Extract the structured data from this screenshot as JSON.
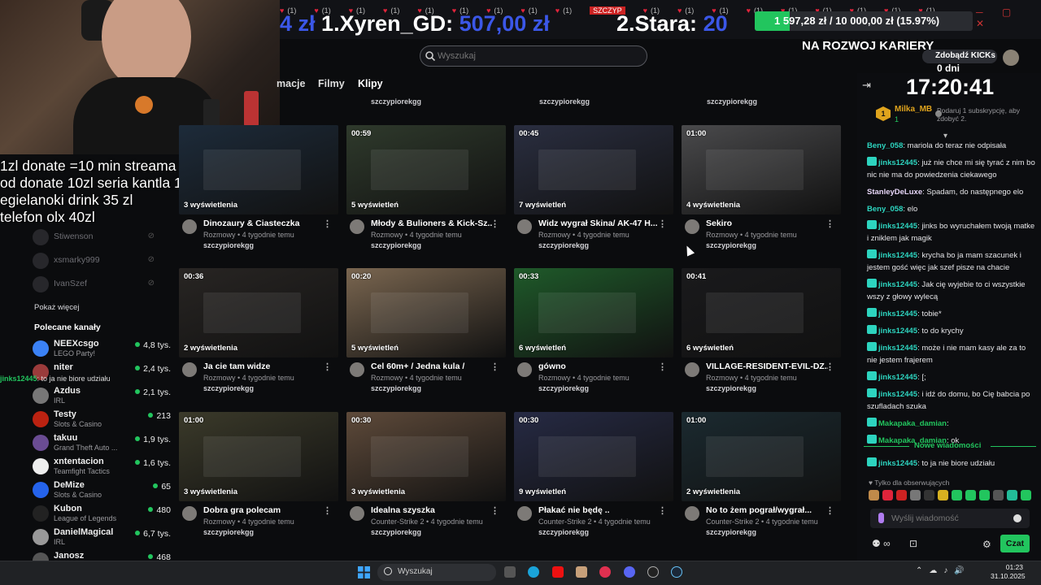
{
  "banner": {
    "ticker_label": "(1)",
    "ticker_count": 18,
    "center_tag": "SZCZYP",
    "leader1_prefix": "4 zł",
    "leader1_name": "1.Xyren_GD:",
    "leader1_amount": "507,00 zł",
    "leader2_name": "2.Stara:",
    "leader2_amount": "20",
    "goal_text": "1 597,28 zł / 10 000,00 zł (15.97%)",
    "goal_percent": 15.97,
    "mission": "NA ROZWOJ KARIERY"
  },
  "overlay_text": "1zl donate =10 min streama\nod donate 10zl seria kantla 15 kg\negielanoki drink 35 zl\ntelefon olx 40zl",
  "sidebar": {
    "offline": [
      {
        "name": "Stiwenson"
      },
      {
        "name": "xsmarky999"
      },
      {
        "name": "IvanSzef"
      }
    ],
    "show_more": "Pokaż więcej",
    "recommended_title": "Polecane kanały",
    "recommended": [
      {
        "name": "NEEXcsgo",
        "game": "LEGO Party!",
        "viewers": "4,8 tys."
      },
      {
        "name": "niter",
        "game": "",
        "viewers": "2,4 tys."
      },
      {
        "name": "Azdus",
        "game": "IRL",
        "viewers": "2,1 tys."
      },
      {
        "name": "Testy",
        "game": "Slots & Casino",
        "viewers": "213"
      },
      {
        "name": "takuu",
        "game": "Grand Theft Auto ...",
        "viewers": "1,9 tys."
      },
      {
        "name": "xntentacion",
        "game": "Teamfight Tactics",
        "viewers": "1,6 tys."
      },
      {
        "name": "DeMize",
        "game": "Slots & Casino",
        "viewers": "65"
      },
      {
        "name": "Kubon",
        "game": "League of Legends",
        "viewers": "480"
      },
      {
        "name": "DanielMagical",
        "game": "IRL",
        "viewers": "6,7 tys."
      },
      {
        "name": "Janosz",
        "game": "",
        "viewers": "468"
      }
    ],
    "ghost_chat_user": "jinks12445",
    "ghost_chat_text": ": to ja nie biore udziału"
  },
  "main": {
    "tabs": [
      "macje",
      "Filmy",
      "Klipy"
    ],
    "active_tab": "Klipy",
    "search_placeholder": "Wyszukaj",
    "channel": "szczypiorekgg",
    "clips": [
      {
        "duration": "",
        "views": "3 wyświetlenia",
        "title": "Dinozaury & Ciasteczka",
        "meta": "Rozmowy • 4 tygodnie temu",
        "channel": "szczypiorekgg",
        "color": "#1d2b3a"
      },
      {
        "duration": "00:59",
        "views": "5 wyświetleń",
        "title": "Młody & Bulioners & Kick-Sz...",
        "meta": "Rozmowy • 4 tygodnie temu",
        "channel": "szczypiorekgg",
        "color": "#2f3a2c"
      },
      {
        "duration": "00:45",
        "views": "7 wyświetleń",
        "title": "Widz wygrał Skina/ AK-47 H...",
        "meta": "Rozmowy • 4 tygodnie temu",
        "channel": "szczypiorekgg",
        "color": "#2a2e40"
      },
      {
        "duration": "01:00",
        "views": "4 wyświetlenia",
        "title": "Sekiro",
        "meta": "Rozmowy • 4 tygodnie temu",
        "channel": "szczypiorekgg",
        "color": "#4a4a4c"
      },
      {
        "duration": "00:36",
        "views": "2 wyświetlenia",
        "title": "Ja cie tam widze",
        "meta": "Rozmowy • 4 tygodnie temu",
        "channel": "szczypiorekgg",
        "color": "#282523"
      },
      {
        "duration": "00:20",
        "views": "5 wyświetleń",
        "title": "Cel 60m+ / Jedna kula /",
        "meta": "Rozmowy • 4 tygodnie temu",
        "channel": "szczypiorekgg",
        "color": "#7a6650"
      },
      {
        "duration": "00:33",
        "views": "6 wyświetleń",
        "title": "gówno",
        "meta": "Rozmowy • 4 tygodnie temu",
        "channel": "szczypiorekgg",
        "color": "#1f5a2a"
      },
      {
        "duration": "00:41",
        "views": "6 wyświetleń",
        "title": "VILLAGE-RESIDENT-EVIL-DZ...",
        "meta": "Rozmowy • 4 tygodnie temu",
        "channel": "szczypiorekgg",
        "color": "#1a1a1c"
      },
      {
        "duration": "01:00",
        "views": "3 wyświetlenia",
        "title": "Dobra gra polecam",
        "meta": "Rozmowy • 4 tygodnie temu",
        "channel": "szczypiorekgg",
        "color": "#3b3a2a"
      },
      {
        "duration": "00:30",
        "views": "3 wyświetlenia",
        "title": "Idealna szyszka",
        "meta": "Counter-Strike 2 • 4 tygodnie temu",
        "channel": "szczypiorekgg",
        "color": "#5e4a3a"
      },
      {
        "duration": "00:30",
        "views": "9 wyświetleń",
        "title": "Płakać nie będę ..",
        "meta": "Counter-Strike 2 • 4 tygodnie temu",
        "channel": "szczypiorekgg",
        "color": "#262a44"
      },
      {
        "duration": "01:00",
        "views": "2 wyświetlenia",
        "title": "No to żem pograł/wygrał...",
        "meta": "Counter-Strike 2 • 4 tygodnie temu",
        "channel": "szczypiorekgg",
        "color": "#1b2a30"
      }
    ]
  },
  "chat": {
    "days": "0 dni",
    "clock": "17:20:41",
    "kicks_label": "Zdobądź KICKs",
    "sub_rank": "1",
    "sub_user": "Milka_MB",
    "sub_count": "1",
    "sub_note": "Podaruj 1 subskrypcję, aby zdobyć 2.",
    "messages": [
      {
        "user": "Beny_058",
        "color": "#2dd4bf",
        "badge": false,
        "text": ": mariola do teraz nie odpisała"
      },
      {
        "user": "jinks12445",
        "color": "#2dd4bf",
        "badge": true,
        "text": ": już nie chce mi się tyrać z nim bo nic nie ma do powiedzenia ciekawego"
      },
      {
        "user": "StanleyDeLuxe",
        "color": "#e7d6f8",
        "badge": false,
        "text": ": Spadam, do następnego elo"
      },
      {
        "user": "Beny_058",
        "color": "#2dd4bf",
        "badge": false,
        "text": ": elo"
      },
      {
        "user": "jinks12445",
        "color": "#2dd4bf",
        "badge": true,
        "text": ": jinks bo wyruchałem twoją matke i zniklem jak magik"
      },
      {
        "user": "jinks12445",
        "color": "#2dd4bf",
        "badge": true,
        "text": ": krycha bo ja mam szacunek i jestem gość więc jak szef pisze na chacie"
      },
      {
        "user": "jinks12445",
        "color": "#2dd4bf",
        "badge": true,
        "text": ": Jak cię wyjebie to ci wszystkie wszy z głowy wylecą"
      },
      {
        "user": "jinks12445",
        "color": "#2dd4bf",
        "badge": true,
        "text": ": tobie*"
      },
      {
        "user": "jinks12445",
        "color": "#2dd4bf",
        "badge": true,
        "text": ": to do krychy"
      },
      {
        "user": "jinks12445",
        "color": "#2dd4bf",
        "badge": true,
        "text": ": może i nie mam kasy ale za to nie jestem frajerem"
      },
      {
        "user": "jinks12445",
        "color": "#2dd4bf",
        "badge": true,
        "text": ": [;"
      },
      {
        "user": "jinks12445",
        "color": "#2dd4bf",
        "badge": true,
        "text": ": i idź do domu, bo Cię babcia po szufladach szuka"
      },
      {
        "user": "Makapaka_damian",
        "color": "#22c55e",
        "badge": true,
        "text": ":"
      },
      {
        "user": "Makapaka_damian",
        "color": "#22c55e",
        "badge": true,
        "text": ": ok"
      }
    ],
    "new_messages": "Nowe wiadomości",
    "last_message": {
      "user": "jinks12445",
      "text": ": to ja nie biore udziału"
    },
    "followers_only": "Tylko dla obserwujących",
    "input_placeholder": "Wyślij wiadomość",
    "send_label": "Czat"
  },
  "taskbar": {
    "search_label": "Wyszukaj",
    "time": "01:23",
    "date": "31.10.2025"
  }
}
